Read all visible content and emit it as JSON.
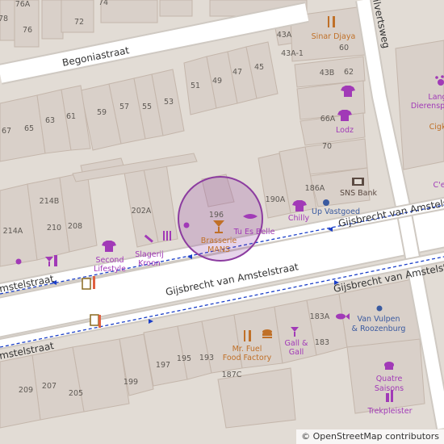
{
  "map": {
    "streets": {
      "begoniastraat": "Begoniastraat",
      "gijsbrecht_main": "Gijsbrecht van Amstelstraat",
      "gijsbrecht_upper": "Gijsbrecht van Amstelstraat",
      "gijsbrecht_lower_right": "Gijsbrecht van Amstelstraat",
      "amstelstraat_left": "mstelstraat",
      "amstelstraat_left_lower": "mstelstraat",
      "hilvertsweg": "ilvertsweg"
    },
    "house_numbers": {
      "n78": "78",
      "n76A": "76A",
      "n76": "76",
      "n72": "72",
      "n74": "74",
      "n59": "59",
      "n57": "57",
      "n55": "55",
      "n53": "53",
      "n51": "51",
      "n49": "49",
      "n47": "47",
      "n45": "45",
      "n67": "67",
      "n65": "65",
      "n63": "63",
      "n61": "61",
      "n43A": "43A",
      "n43A1": "43A-1",
      "n60": "60",
      "n43B": "43B",
      "n62": "62",
      "n66A": "66A",
      "n70": "70",
      "n186A": "186A",
      "n190A": "190A",
      "n196": "196",
      "n202A": "202A",
      "n214B": "214B",
      "n214A": "214A",
      "n210": "210",
      "n208": "208",
      "n195": "195",
      "n193": "193",
      "n197": "197",
      "n187C": "187C",
      "n183A": "183A",
      "n183": "183",
      "n199": "199",
      "n209": "209",
      "n207": "207",
      "n205": "205"
    },
    "pois": {
      "sinar_djaya": "Sinar Djaya",
      "lange_dierenspeciaal_1": "Lang",
      "lange_dierenspeciaal_2": "Dierensp",
      "cigk": "Cigk",
      "lodz": "Lodz",
      "ce": "C'e",
      "sns_bank": "SNS Bank",
      "up_vastgoed": "Up Vastgoed",
      "chilly": "Chilly",
      "tu_es_belle": "Tu Es Belle",
      "brasserie_1": "Brasserie",
      "brasserie_2": "MANS",
      "slagerij_1": "Slagerij",
      "slagerij_2": "Kroon",
      "second_lifestyle_1": "Second",
      "second_lifestyle_2": "Lifestyle",
      "mr_fuel_1": "Mr. Fuel",
      "mr_fuel_2": "Food Factory",
      "gall_1": "Gall &",
      "gall_2": "Gall",
      "van_vulpen_1": "Van Vulpen",
      "van_vulpen_2": "& Roozenburg",
      "quatre_1": "Quatre",
      "quatre_2": "Saisons",
      "trekpleister": "Trekpleister"
    },
    "attribution": "© OpenStreetMap contributors",
    "colors": {
      "background": "#e2dcd5",
      "building": "#d9d0c9",
      "road": "#ffffff",
      "bus_route": "#1a3ec8",
      "poi_purple": "#a13ab7",
      "poi_orange": "#c07028",
      "highlight_circle": "#8c3ca0"
    }
  }
}
